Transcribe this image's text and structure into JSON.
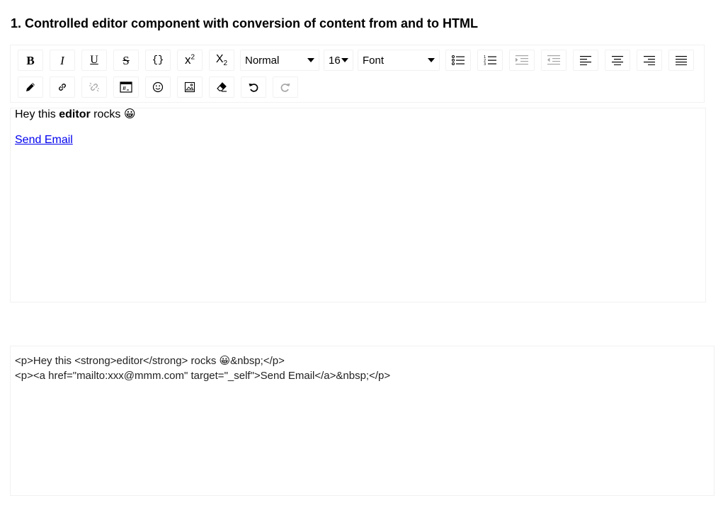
{
  "heading": "1. Controlled editor component with conversion of content from and to HTML",
  "toolbar": {
    "bold": "B",
    "italic": "I",
    "underline": "U",
    "strikethrough": "S",
    "monospace": "{}",
    "superscript_base": "x",
    "superscript_mark": "2",
    "subscript_base": "X",
    "subscript_mark": "2",
    "block_type": "Normal",
    "font_size": "16",
    "font_family": "Font"
  },
  "editor": {
    "line1_before": "Hey this ",
    "line1_bold": "editor",
    "line1_after": " rocks ",
    "emoji": "😀",
    "link_text": "Send Email",
    "link_href": "mailto:xxx@mmm.com"
  },
  "html_output": {
    "line1_before": "<p>Hey this <strong>editor</strong> rocks ",
    "line1_emoji": "😀",
    "line1_after": "&nbsp;</p>",
    "line2": "<p><a href=\"mailto:xxx@mmm.com\" target=\"_self\">Send Email</a>&nbsp;</p>"
  }
}
